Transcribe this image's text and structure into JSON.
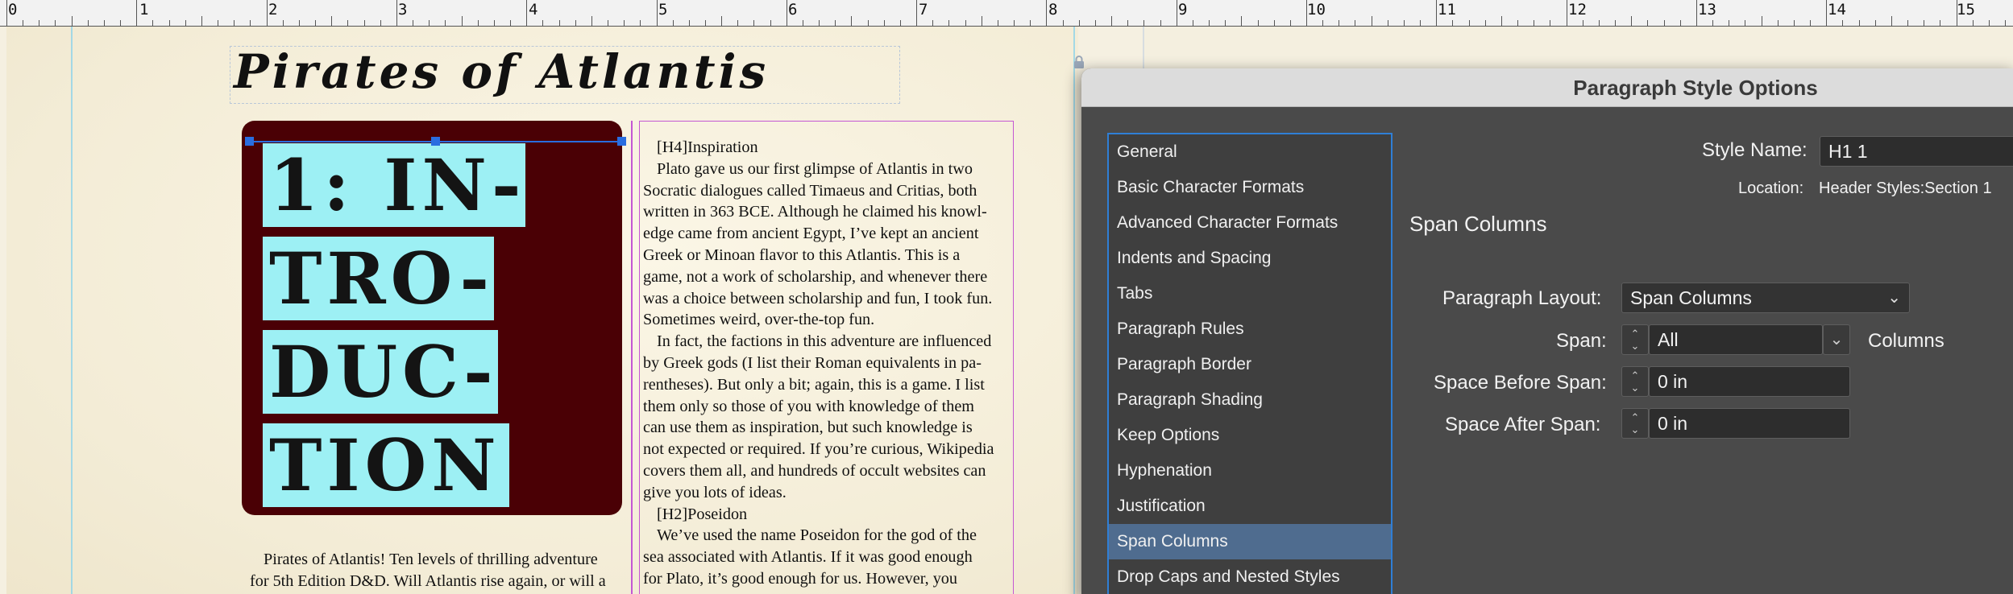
{
  "ruler": {
    "marks": [
      "0",
      "1",
      "2",
      "3",
      "4",
      "5",
      "6",
      "7",
      "8",
      "9",
      "10",
      "11",
      "12",
      "13",
      "14",
      "15"
    ]
  },
  "document": {
    "title": "Pirates of Atlantis",
    "intro_lines": [
      "1:  IN-",
      "TRO-",
      "DUC-",
      "TION"
    ],
    "left_column": [
      "Pirates of Atlantis! Ten levels of thrilling adventure",
      "for 5th Edition D&D. Will Atlantis rise again, or will a"
    ],
    "right_column": [
      "[H4]Inspiration",
      "Plato gave us our first glimpse of Atlantis in two",
      "Socratic dialogues called Timaeus and Critias, both",
      "written in 363 BCE. Although he claimed his knowl-",
      "edge came from ancient Egypt, I’ve kept an ancient",
      "Greek or Minoan flavor to this Atlantis. This is a",
      "game, not a work of scholarship, and whenever there",
      "was a choice between scholarship and fun, I took fun.",
      "Sometimes weird, over-the-top fun.",
      "In fact, the factions in this adventure are influenced",
      "by Greek gods (I list their Roman equivalents in pa-",
      "rentheses). But only a bit; again, this is a game. I list",
      "them only so those of you with knowledge of them",
      "can use them as inspiration, but such knowledge is",
      "not expected or required. If you’re curious, Wikipedia",
      "covers them all, and hundreds of occult websites can",
      "give you lots of ideas.",
      "[H2]Poseidon",
      "We’ve used the name Poseidon for the god of the",
      "sea associated with Atlantis. If it was good enough",
      "for Plato, it’s good enough for us. However, you"
    ]
  },
  "dialog": {
    "title": "Paragraph Style Options",
    "style_name_label": "Style Name:",
    "style_name_value": "H1 1",
    "location_label": "Location:",
    "location_value": "Header Styles:Section 1",
    "section_heading": "Span Columns",
    "categories": [
      "General",
      "Basic Character Formats",
      "Advanced Character Formats",
      "Indents and Spacing",
      "Tabs",
      "Paragraph Rules",
      "Paragraph Border",
      "Paragraph Shading",
      "Keep Options",
      "Hyphenation",
      "Justification",
      "Span Columns",
      "Drop Caps and Nested Styles"
    ],
    "selected_category": "Span Columns",
    "paragraph_layout_label": "Paragraph Layout:",
    "paragraph_layout_value": "Span Columns",
    "span_label": "Span:",
    "span_value": "All",
    "span_suffix": "Columns",
    "space_before_label": "Space Before Span:",
    "space_before_value": "0 in",
    "space_after_label": "Space After Span:",
    "space_after_value": "0 in"
  },
  "colors": {
    "intro_bg": "#4a0005",
    "intro_highlight": "#9df0f4",
    "selection": "#2a6de0",
    "frame": "#c457d3",
    "dialog_bg": "#4a4a4a"
  }
}
